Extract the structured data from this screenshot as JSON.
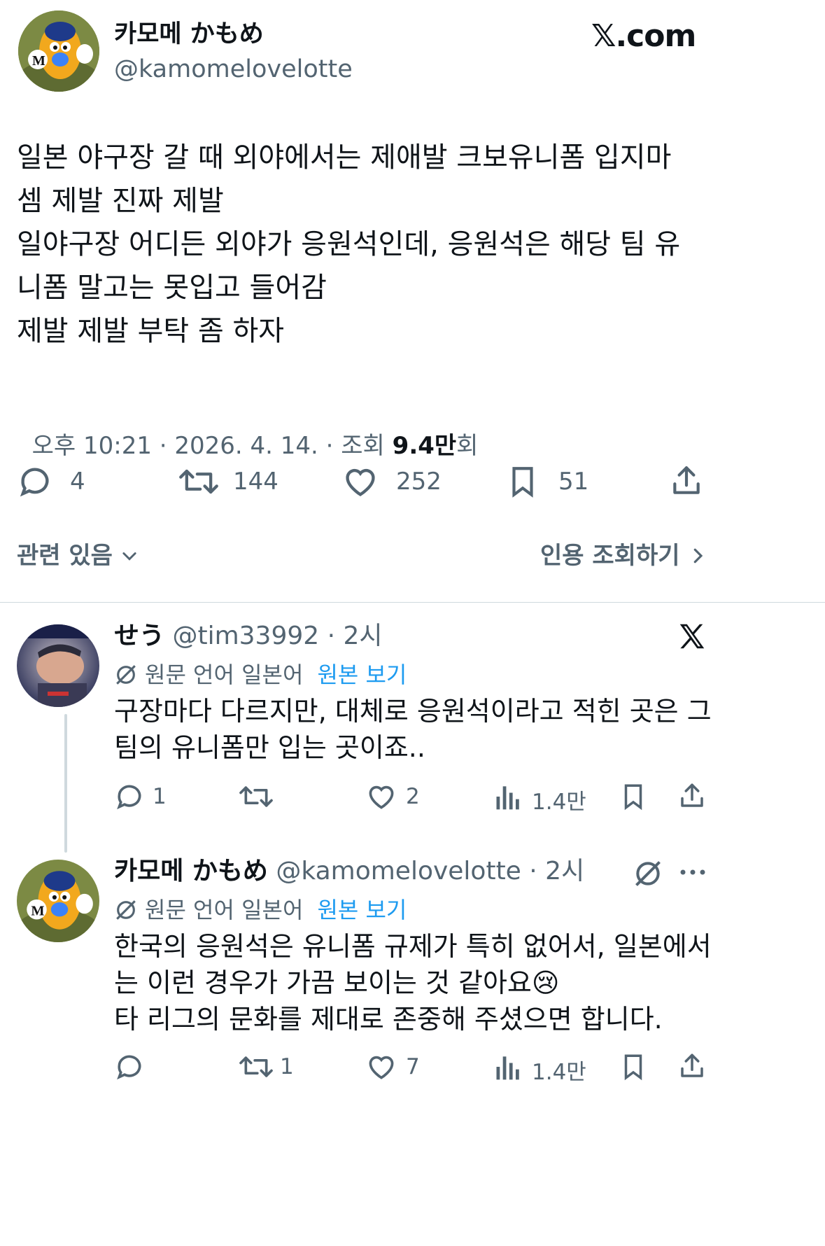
{
  "main_tweet": {
    "display_name": "카모메 かもめ",
    "handle": "@kamomelovelotte",
    "source_brand": "𝕏.com",
    "body_lines": [
      "일본 야구장 갈 때 외야에서는 제애발 크보유니폼 입지마",
      "셈 제발 진짜 제발",
      "일야구장 어디든 외야가 응원석인데, 응원석은 해당 팀 유",
      "니폼 말고는 못입고 들어감",
      "제발 제발 부탁 좀 하자"
    ],
    "timestamp": "오후 10:21 · 2026. 4. 14. · 조회 ",
    "views_number": "9.4만",
    "views_suffix": "회",
    "stats": {
      "replies": "4",
      "retweets": "144",
      "likes": "252",
      "bookmarks": "51"
    },
    "related_label": "관련 있음",
    "quotes_label": "인용 조회하기"
  },
  "replies": [
    {
      "display_name": "せう",
      "handle_time": "@tim33992 · 2시",
      "translated_label": "원문 언어 일본어",
      "show_original": "원본 보기",
      "body_lines": [
        "구장마다 다르지만, 대체로 응원석이라고 적힌 곳은 그",
        "팀의 유니폼만 입는 곳이죠.."
      ],
      "stats": {
        "replies": "1",
        "retweets": "",
        "likes": "2",
        "views": "1.4만"
      }
    },
    {
      "display_name": "카모메 かもめ",
      "handle_time": "@kamomelovelotte · 2시",
      "translated_label": "원문 언어 일본어",
      "show_original": "원본 보기",
      "body_lines": [
        "한국의 응원석은 유니폼 규제가 특히 없어서, 일본에서",
        "는 이런 경우가 가끔 보이는 것 같아요",
        "타 리그의 문화를 제대로 존중해 주셨으면 합니다."
      ],
      "emoji": "😢",
      "stats": {
        "replies": "",
        "retweets": "1",
        "likes": "7",
        "views": "1.4만"
      }
    }
  ],
  "colors": {
    "text": "#0f1419",
    "muted": "#536471",
    "link": "#1d9bf0",
    "divider": "#cfd9de"
  }
}
